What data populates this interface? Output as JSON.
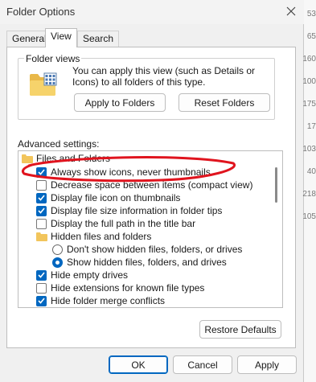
{
  "window": {
    "title": "Folder Options"
  },
  "tabs": [
    {
      "label": "General"
    },
    {
      "label": "View"
    },
    {
      "label": "Search"
    }
  ],
  "folder_views": {
    "title": "Folder views",
    "description": "You can apply this view (such as Details or Icons) to all folders of this type.",
    "apply_label": "Apply to Folders",
    "reset_label": "Reset Folders"
  },
  "advanced": {
    "label": "Advanced settings:",
    "items": [
      {
        "kind": "folder",
        "label": "Files and Folders"
      },
      {
        "kind": "checkbox",
        "checked": true,
        "label": "Always show icons, never thumbnails"
      },
      {
        "kind": "checkbox",
        "checked": false,
        "label": "Decrease space between items (compact view)"
      },
      {
        "kind": "checkbox",
        "checked": true,
        "label": "Display file icon on thumbnails"
      },
      {
        "kind": "checkbox",
        "checked": true,
        "label": "Display file size information in folder tips"
      },
      {
        "kind": "checkbox",
        "checked": false,
        "label": "Display the full path in the title bar"
      },
      {
        "kind": "folder",
        "label": "Hidden files and folders"
      },
      {
        "kind": "radio",
        "checked": false,
        "label": "Don't show hidden files, folders, or drives"
      },
      {
        "kind": "radio",
        "checked": true,
        "label": "Show hidden files, folders, and drives"
      },
      {
        "kind": "checkbox",
        "checked": true,
        "label": "Hide empty drives"
      },
      {
        "kind": "checkbox",
        "checked": false,
        "label": "Hide extensions for known file types"
      },
      {
        "kind": "checkbox",
        "checked": true,
        "label": "Hide folder merge conflicts"
      }
    ]
  },
  "restore_label": "Restore Defaults",
  "footer": {
    "ok_label": "OK",
    "cancel_label": "Cancel",
    "apply_label": "Apply"
  },
  "background_numbers": [
    "53",
    "65",
    "160",
    "100",
    "175",
    "17",
    "103",
    "40",
    "218",
    "105"
  ],
  "colors": {
    "accent": "#0067c0",
    "annotation": "#e0141e"
  }
}
